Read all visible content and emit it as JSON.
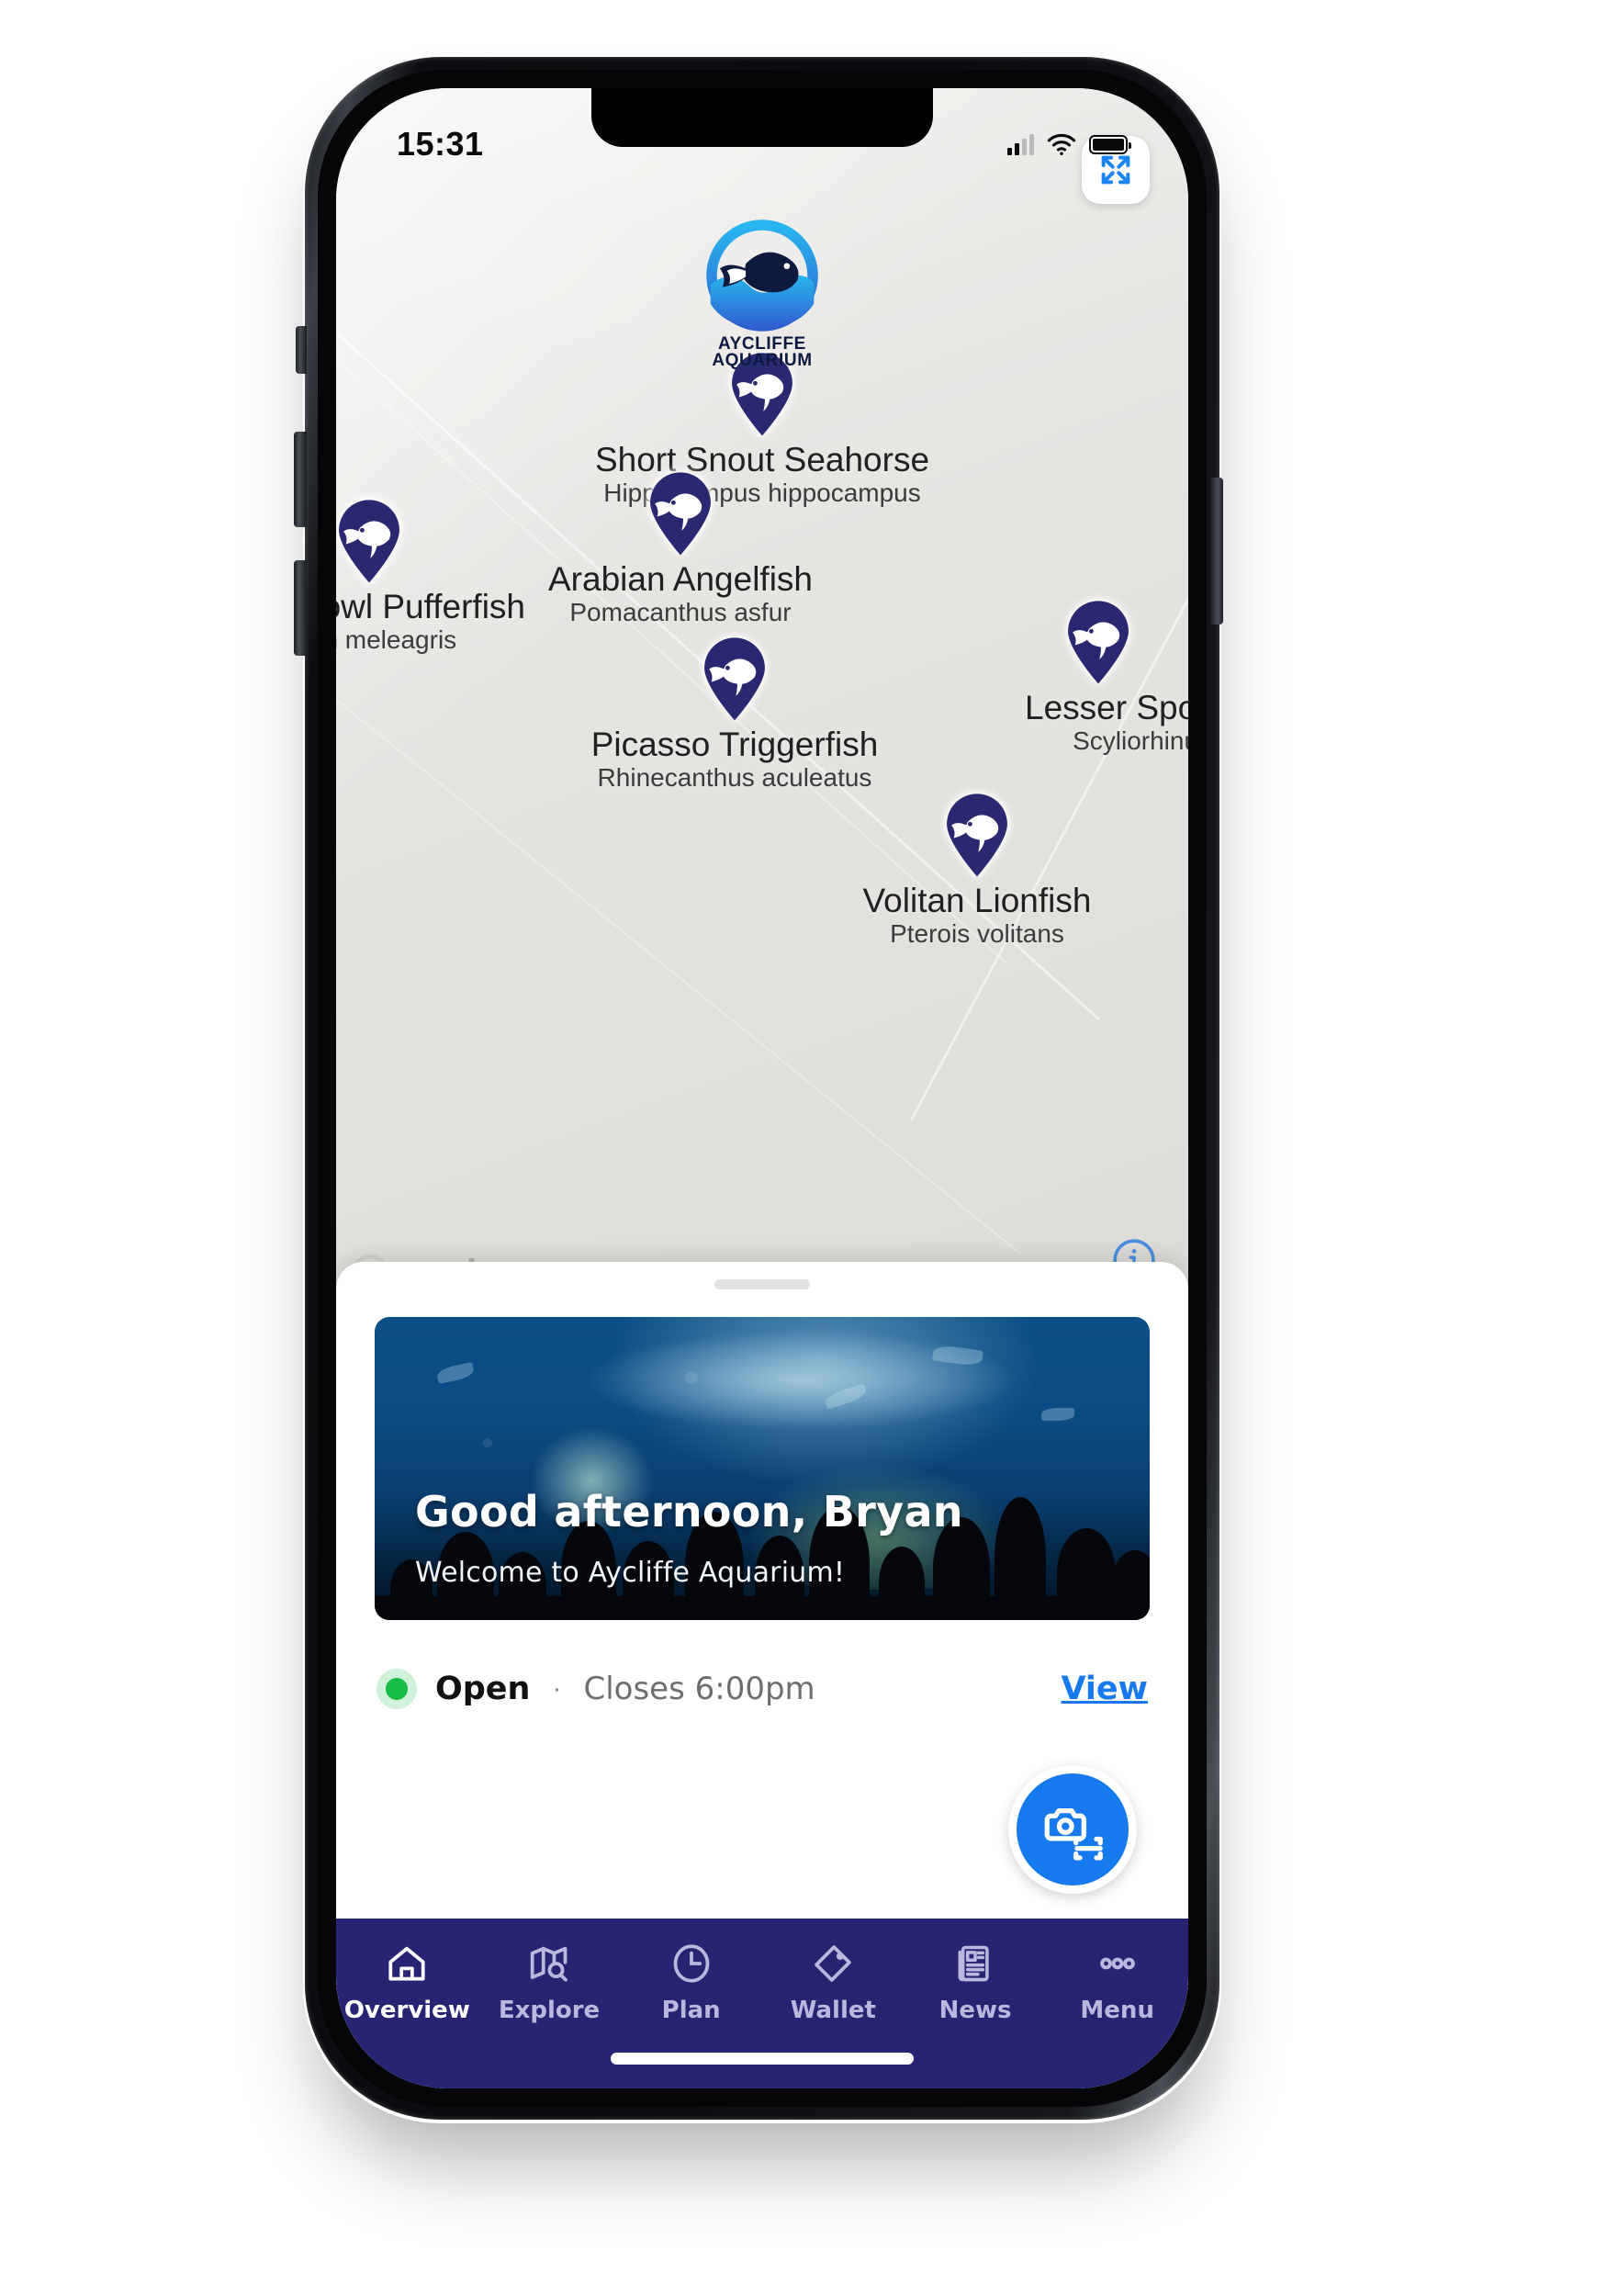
{
  "status_bar": {
    "time": "15:31",
    "signal_icon": "cellular-bars-icon",
    "wifi_icon": "wifi-icon",
    "battery_icon": "battery-icon"
  },
  "map": {
    "logo": {
      "line1": "AYCLIFFE",
      "line2": "AQUARIUM",
      "icon": "aquarium-fish-logo"
    },
    "expand_button_icon": "expand-arrows-icon",
    "info_button_icon": "info-circle-icon",
    "attribution": "mapbox",
    "attribution_prefix": "a",
    "markers": [
      {
        "name": "Short Snout Seahorse",
        "species": "Hippocampus hippocampus"
      },
      {
        "name": "Arabian Angelfish",
        "species": "Pomacanthus asfur"
      },
      {
        "name": "Fowl Pufferfish",
        "species": "hron meleagris"
      },
      {
        "name": "Lesser Spotted",
        "species": "Scyliorhinus c"
      },
      {
        "name": "Picasso Triggerfish",
        "species": "Rhinecanthus aculeatus"
      },
      {
        "name": "Volitan Lionfish",
        "species": "Pterois volitans"
      }
    ]
  },
  "sheet": {
    "hero": {
      "title": "Good afternoon, Bryan",
      "subtitle": "Welcome to Aycliffe Aquarium!"
    },
    "status": {
      "state": "Open",
      "separator": "·",
      "closes": "Closes 6:00pm",
      "link": "View",
      "dot_color": "#18bd45"
    },
    "scan_button_icon": "camera-scan-icon",
    "scan_button_color": "#1779ee"
  },
  "nav": {
    "items": [
      {
        "label": "Overview",
        "icon": "home-icon",
        "active": true
      },
      {
        "label": "Explore",
        "icon": "map-search-icon",
        "active": false
      },
      {
        "label": "Plan",
        "icon": "clock-icon",
        "active": false
      },
      {
        "label": "Wallet",
        "icon": "ticket-tag-icon",
        "active": false
      },
      {
        "label": "News",
        "icon": "newspaper-icon",
        "active": false
      },
      {
        "label": "Menu",
        "icon": "ellipsis-icon",
        "active": false
      }
    ]
  }
}
